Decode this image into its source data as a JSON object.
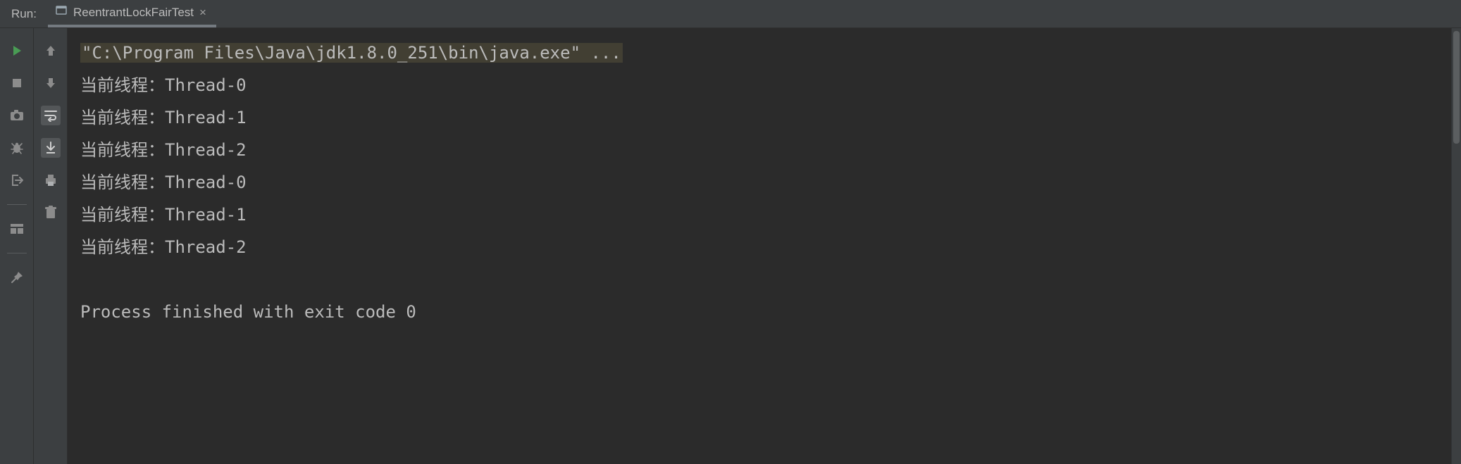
{
  "header": {
    "run_label": "Run:",
    "tab_title": "ReentrantLockFairTest",
    "close_glyph": "×"
  },
  "toolbar1": {
    "rerun": "rerun-icon",
    "stop": "stop-icon",
    "camera": "camera-icon",
    "bug": "bug-icon",
    "exit": "exit-icon",
    "layout": "layout-icon",
    "pin": "pin-icon"
  },
  "toolbar2": {
    "up": "up-icon",
    "down": "down-icon",
    "wrap": "wrap-icon",
    "scroll_end": "scroll-end-icon",
    "print": "print-icon",
    "trash": "trash-icon"
  },
  "console": {
    "command_line": "\"C:\\Program Files\\Java\\jdk1.8.0_251\\bin\\java.exe\" ...",
    "line_prefix": "当前线程：",
    "lines": [
      "Thread-0",
      "Thread-1",
      "Thread-2",
      "Thread-0",
      "Thread-1",
      "Thread-2"
    ],
    "exit_message": "Process finished with exit code 0"
  }
}
